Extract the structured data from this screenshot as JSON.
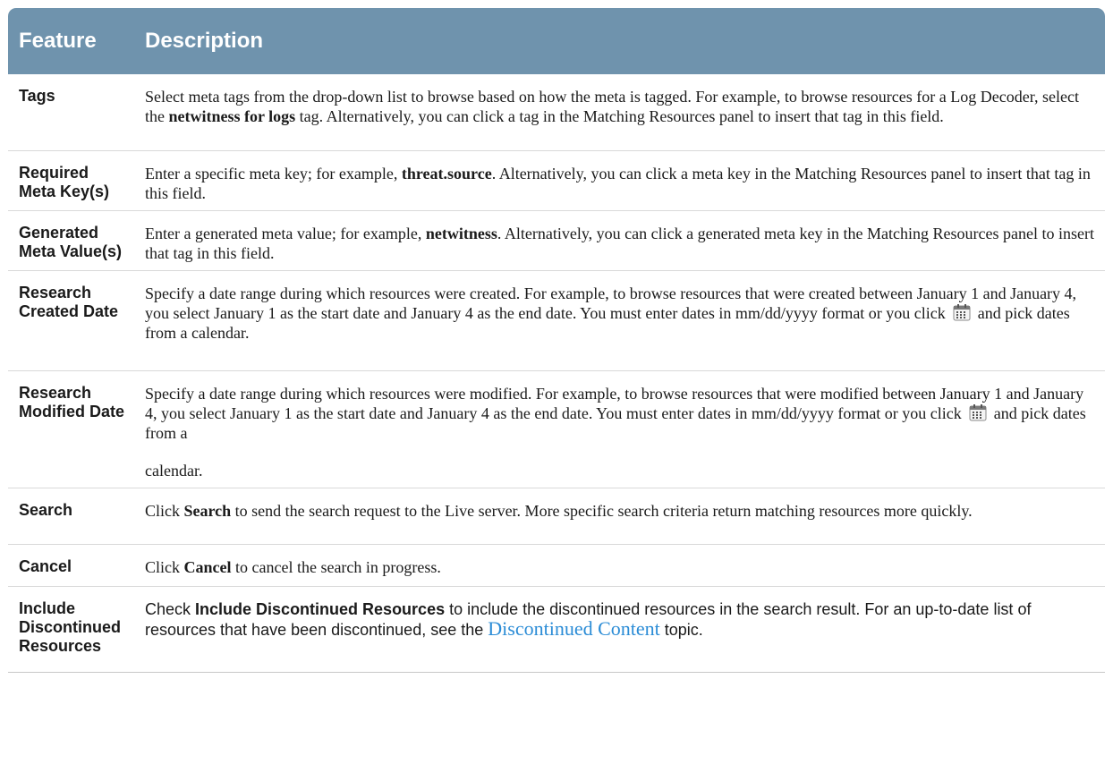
{
  "header": {
    "feature": "Feature",
    "description": "Description"
  },
  "colors": {
    "header_bg": "#6f93ad",
    "link": "#2b8cd6"
  },
  "rows": [
    {
      "feature": "Tags",
      "d": [
        "Select meta tags from the drop-down list to browse based on how the meta is tagged. For example, to browse resources for a Log Decoder, select the ",
        "netwitness for logs",
        " tag. Alternatively, you can click a tag in the Matching Resources panel to insert that tag in this field."
      ]
    },
    {
      "feature": "Required Meta Key(s)",
      "d": [
        "Enter a specific meta key; for example, ",
        "threat.source",
        ". Alternatively, you can click a meta key in the Matching Resources panel to insert that tag in this field."
      ]
    },
    {
      "feature": "Generated Meta Value(s)",
      "d": [
        "Enter a generated meta value; for example, ",
        "netwitness",
        ". Alternatively, you can click a generated meta key in the Matching Resources panel to insert that tag in this field."
      ]
    },
    {
      "feature": "Research Created Date",
      "d": [
        "Specify a date range during which resources were created. For example, to browse resources that were created between January 1 and January 4, you select January 1 as the start date and January 4 as the end date. You must enter dates in mm/dd/yyyy format or you click",
        "and pick dates from a calendar."
      ]
    },
    {
      "feature": "Research Modified Date",
      "d": [
        "Specify a date range during which resources were modified. For example, to browse resources that were modified between January 1 and January 4, you select January 1 as the start date and January 4 as the end date. You must enter dates in mm/dd/yyyy format or you click",
        "and pick dates from a",
        "calendar."
      ]
    },
    {
      "feature": "Search",
      "d": [
        "Click ",
        "Search",
        " to send the search request to the Live server. More specific search criteria return matching resources more quickly."
      ]
    },
    {
      "feature": "Cancel",
      "d": [
        "Click ",
        "Cancel",
        " to cancel the search in progress."
      ]
    },
    {
      "feature": "Include Discontinued Resources",
      "d": [
        "Check ",
        "Include Discontinued Resources",
        " to include the discontinued resources in the search result. For an up-to-date list of resources that have been discontinued, see the ",
        "Discontinued Content",
        " topic."
      ]
    }
  ]
}
